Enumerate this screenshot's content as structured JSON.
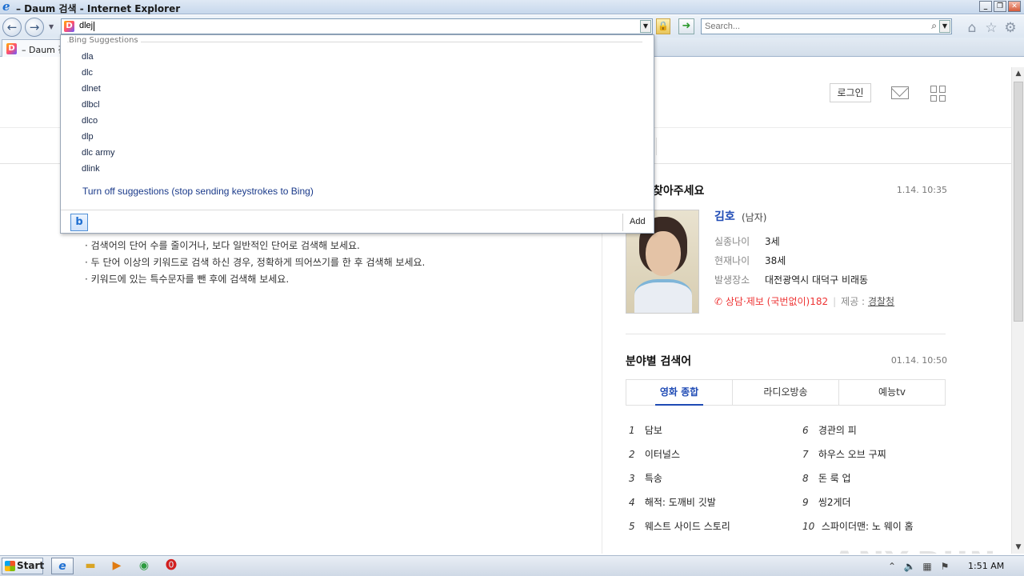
{
  "window": {
    "title": "– Daum 검색 - Internet Explorer",
    "min_label": "_",
    "restore_label": "❐",
    "close_label": "✕"
  },
  "nav": {
    "back_glyph": "←",
    "forward_glyph": "→",
    "address_value": "dlej",
    "search_placeholder": "Search..."
  },
  "tab": {
    "label": "– Daum 검색"
  },
  "suggestions": {
    "header": "Bing Suggestions",
    "items": [
      "dla",
      "dlc",
      "dlnet",
      "dlbcl",
      "dlco",
      "dlp",
      "dlc army",
      "dlink"
    ],
    "turn_off": "Turn off suggestions (stop sending keystrokes to Bing)",
    "add_label": "Add"
  },
  "header": {
    "login_label": "로그인"
  },
  "tips": [
    "· 검색어의 단어 수를 줄이거나, 보다 일반적인 단어로 검색해 보세요.",
    "· 두 단어 이상의 키워드로 검색 하신 경우, 정확하게 띄어쓰기를 한 후 검색해 보세요.",
    "· 키워드에 있는 특수문자를 뺀 후에 검색해 보세요."
  ],
  "missing": {
    "title": "찾아주세요",
    "date": "1.14. 10:35",
    "name": "김호",
    "gender": "(남자)",
    "fields": [
      {
        "key": "실종나이",
        "value": "3세"
      },
      {
        "key": "현재나이",
        "value": "38세"
      },
      {
        "key": "발생장소",
        "value": "대전광역시 대덕구 비래동"
      }
    ],
    "hotline": "상담·제보 (국번없이)182",
    "provider_label": "제공 :",
    "provider": "경찰청"
  },
  "category": {
    "title": "분야별 검색어",
    "date": "01.14. 10:50",
    "tabs": [
      "영화 종합",
      "라디오방송",
      "예능tv"
    ],
    "left": [
      {
        "rank": "1",
        "term": "담보"
      },
      {
        "rank": "2",
        "term": "이터널스"
      },
      {
        "rank": "3",
        "term": "특송"
      },
      {
        "rank": "4",
        "term": "해적: 도깨비 깃발"
      },
      {
        "rank": "5",
        "term": "웨스트 사이드 스토리"
      }
    ],
    "right": [
      {
        "rank": "6",
        "term": "경관의 피"
      },
      {
        "rank": "7",
        "term": "하우스 오브 구찌"
      },
      {
        "rank": "8",
        "term": "돈 룩 업"
      },
      {
        "rank": "9",
        "term": "씽2게더"
      },
      {
        "rank": "10",
        "term": "스파이더맨: 노 웨이 홈"
      }
    ]
  },
  "taskbar": {
    "start_label": "Start",
    "clock": "1:51 AM"
  },
  "watermark": "ANY.RUN"
}
